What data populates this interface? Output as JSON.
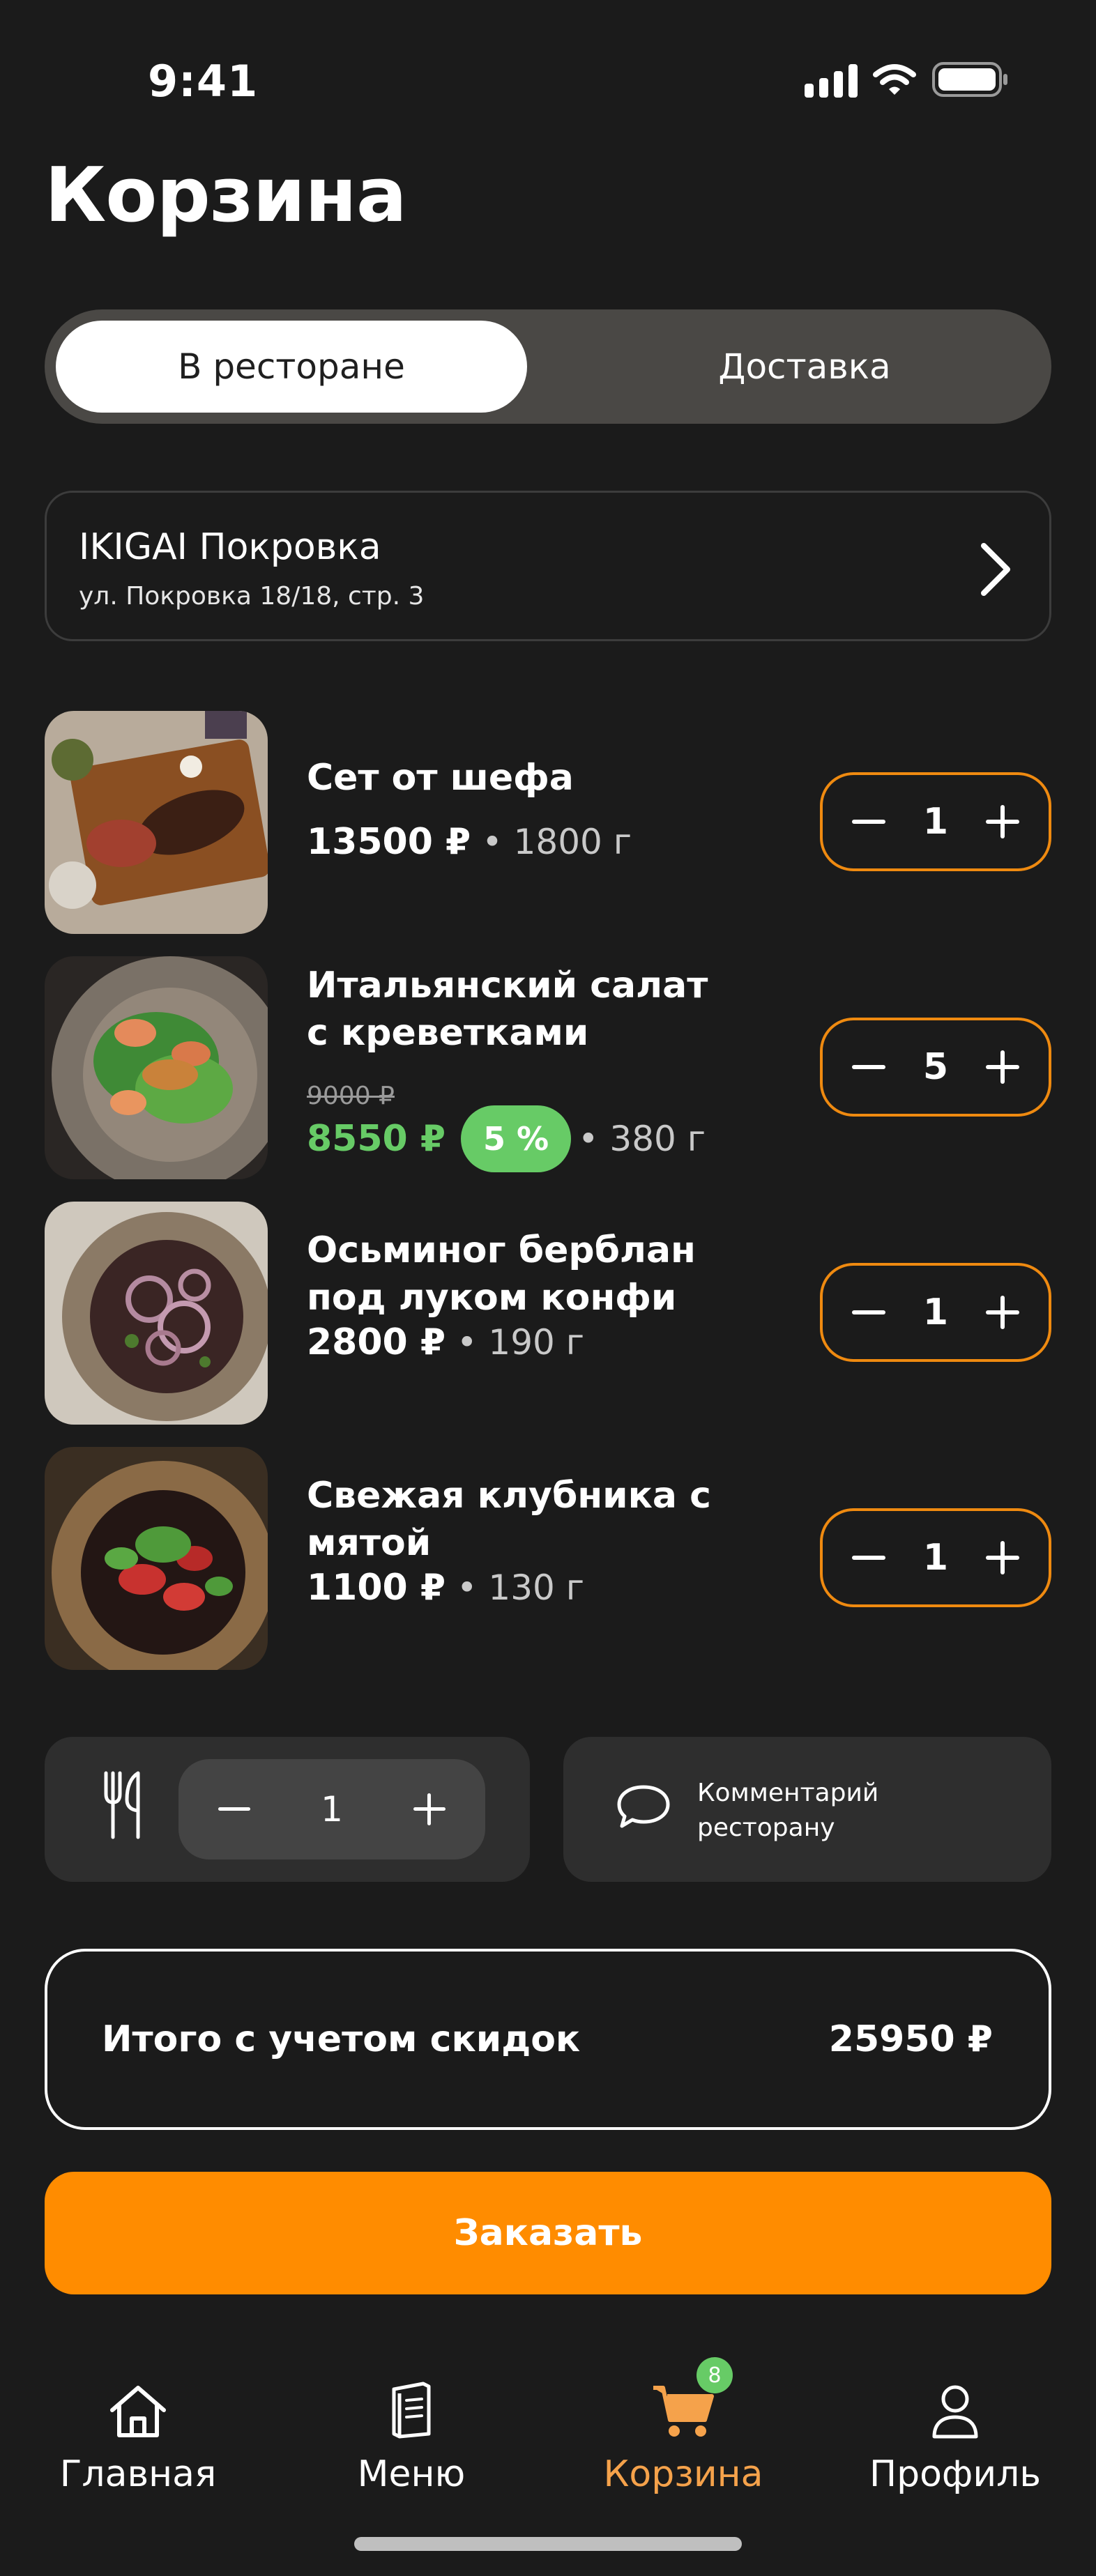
{
  "status_bar": {
    "time": "9:41"
  },
  "page": {
    "title": "Корзина"
  },
  "tabs": [
    {
      "label": "В ресторане",
      "active": true
    },
    {
      "label": "Доставка",
      "active": false
    }
  ],
  "restaurant": {
    "name": "IKIGAI Покровка",
    "address": "ул. Покровка 18/18, стр. 3"
  },
  "items": [
    {
      "name": "Сет от шефа",
      "price": "13500 ₽",
      "weight": "• 1800 г",
      "quantity": "1"
    },
    {
      "name": "Итальянский салат с креветками",
      "old_price": "9000 ₽",
      "price": "8550 ₽",
      "discount": "5 %",
      "weight": "• 380 г",
      "quantity": "5"
    },
    {
      "name": "Осьминог берблан под луком конфи",
      "price": "2800 ₽",
      "weight": "• 190 г",
      "quantity": "1"
    },
    {
      "name": "Свежая клубника с мятой",
      "price": "1100 ₽",
      "weight": "• 130 г",
      "quantity": "1"
    }
  ],
  "cutlery": {
    "quantity": "1"
  },
  "comment": {
    "label": "Комментарий ресторану"
  },
  "total": {
    "label": "Итого с учетом скидок",
    "value": "25950 ₽"
  },
  "order_button": {
    "label": "Заказать"
  },
  "nav": {
    "items": [
      {
        "label": "Главная",
        "icon": "home-icon"
      },
      {
        "label": "Меню",
        "icon": "menu-book-icon"
      },
      {
        "label": "Корзина",
        "icon": "cart-icon",
        "active": true,
        "badge": "8"
      },
      {
        "label": "Профиль",
        "icon": "profile-icon"
      }
    ]
  },
  "colors": {
    "background": "#1b1b1b",
    "accent": "#ff8c00",
    "discount": "#67cb66",
    "nav_active": "#f5a24b"
  }
}
